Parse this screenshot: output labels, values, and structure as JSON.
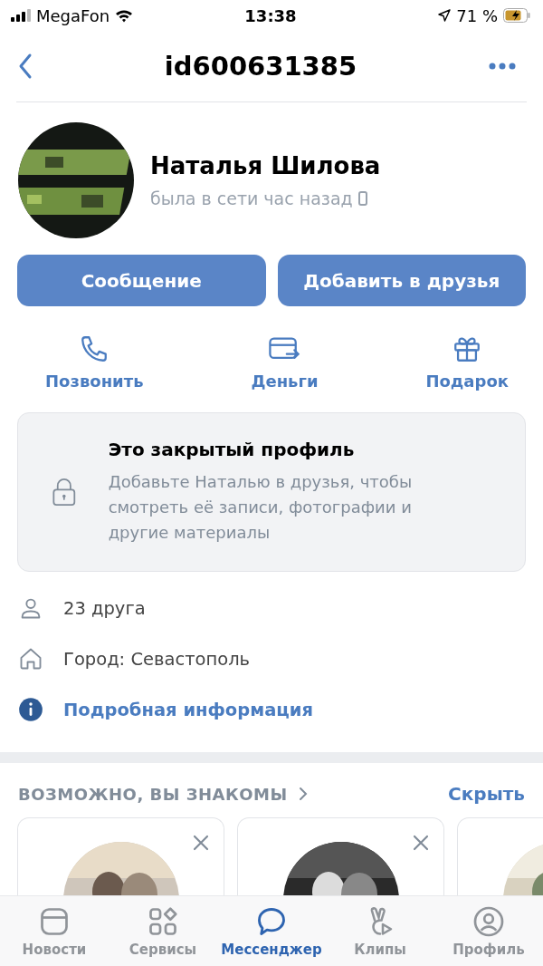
{
  "status_bar": {
    "carrier": "MegaFon",
    "time": "13:38",
    "battery": "71 %"
  },
  "nav": {
    "title": "id600631385"
  },
  "profile": {
    "avatar": {
      "kind": "picture"
    },
    "name": "Наталья Шилова",
    "last_seen": "была в сети час назад"
  },
  "buttons": [
    {
      "label": "Сообщение"
    },
    {
      "label": "Добавить в друзья"
    }
  ],
  "actions": [
    {
      "kind": "phone",
      "label": "Позвонить"
    },
    {
      "kind": "money",
      "label": "Деньги"
    },
    {
      "kind": "gift",
      "label": "Подарок"
    }
  ],
  "closed_notice": {
    "title": "Это закрытый профиль",
    "text": "Добавьте Наталью в друзья, чтобы смотреть её записи, фотографии и другие материалы"
  },
  "info": [
    {
      "kind": "friends",
      "text": "23 друга",
      "link": false
    },
    {
      "kind": "city",
      "text": "Город: Севастополь",
      "link": false
    },
    {
      "kind": "details",
      "text": "Подробная информация",
      "link": true
    }
  ],
  "suggestions": {
    "title": "ВОЗМОЖНО, ВЫ ЗНАКОМЫ",
    "action": "Скрыть",
    "cards": [
      {
        "kind": "picture",
        "closable": true
      },
      {
        "kind": "picture",
        "closable": true
      },
      {
        "kind": "picture"
      }
    ]
  },
  "tab_bar": [
    {
      "kind": "news",
      "label": "Новости",
      "selected": false
    },
    {
      "kind": "services",
      "label": "Сервисы",
      "selected": false
    },
    {
      "kind": "messenger",
      "label": "Мессенджер",
      "selected": true
    },
    {
      "kind": "clips",
      "label": "Клипы",
      "selected": false
    },
    {
      "kind": "profile",
      "label": "Профиль",
      "selected": false
    }
  ]
}
